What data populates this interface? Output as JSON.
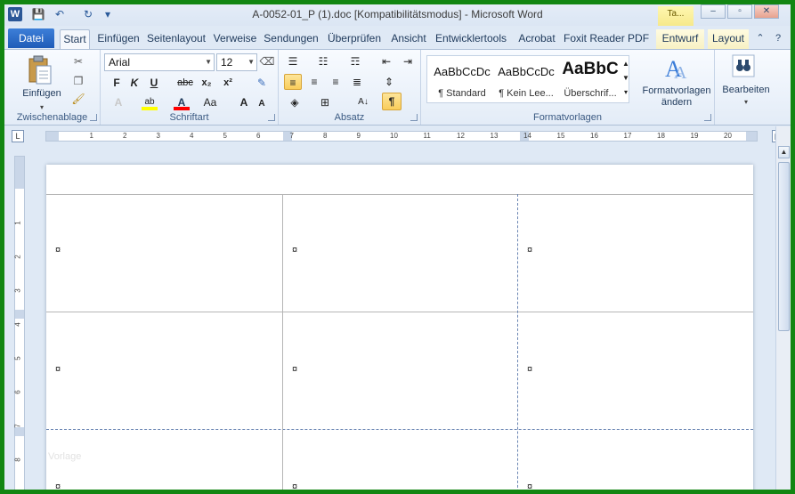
{
  "window": {
    "title": "A-0052-01_P (1).doc [Kompatibilitätsmodus] - Microsoft Word",
    "context_tab_top": "Ta..."
  },
  "tabs": {
    "file": "Datei",
    "items": [
      "Start",
      "Einfügen",
      "Seitenlayout",
      "Verweise",
      "Sendungen",
      "Überprüfen",
      "Ansicht",
      "Entwicklertools",
      "Acrobat",
      "Foxit Reader PDF",
      "Entwurf",
      "Layout"
    ]
  },
  "ribbon": {
    "clipboard": {
      "label": "Zwischenablage",
      "paste": "Einfügen"
    },
    "font": {
      "label": "Schriftart",
      "name": "Arial",
      "size": "12",
      "bold": "F",
      "italic": "K",
      "underline": "U",
      "strike": "abc",
      "sub": "x₂",
      "sup": "x²",
      "grow": "A",
      "shrink": "A",
      "case": "Aa"
    },
    "paragraph": {
      "label": "Absatz",
      "pilcrow": "¶"
    },
    "styles": {
      "label": "Formatvorlagen",
      "items": [
        {
          "sample": "AaBbCcDc",
          "name": "¶ Standard"
        },
        {
          "sample": "AaBbCcDc",
          "name": "¶ Kein Lee..."
        },
        {
          "sample": "AaBbC",
          "name": "Überschrif..."
        }
      ],
      "change": "Formatvorlagen ändern"
    },
    "editing": {
      "label": "Bearbeiten"
    }
  },
  "ruler": {
    "h_ticks": [
      "1",
      "2",
      "3",
      "4",
      "5",
      "6",
      "7",
      "8",
      "9",
      "10",
      "11",
      "12",
      "13",
      "14",
      "15",
      "16",
      "17",
      "18",
      "19",
      "20"
    ],
    "v_ticks": [
      "1",
      "2",
      "3",
      "4",
      "5",
      "6",
      "7",
      "8"
    ]
  },
  "document": {
    "cell_mark": "¤",
    "watermark": "Vorlage"
  },
  "colors": {
    "frame": "#128612",
    "file_tab": "#2b66c1",
    "selected": "#f9cd5b"
  }
}
